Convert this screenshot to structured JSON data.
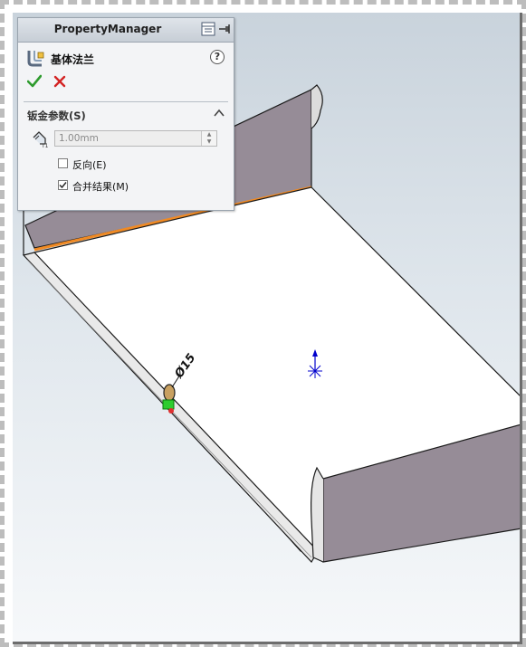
{
  "property_manager": {
    "title": "PropertyManager",
    "feature_name": "基体法兰",
    "help_symbol": "?",
    "ok_icon": "check-icon",
    "cancel_icon": "x-icon",
    "group": {
      "title": "钣金参数(S)",
      "thickness": {
        "value": "1.00mm"
      },
      "reverse_direction": {
        "label": "反向(E)",
        "checked": false
      },
      "merge_result": {
        "label": "合并结果(M)",
        "checked": true
      }
    }
  },
  "viewport": {
    "dimension_label": "Ø15"
  },
  "colors": {
    "ok": "#2e9b2e",
    "cancel": "#d32424",
    "wall": "#968c97",
    "edge_highlight": "#f08a24",
    "axis": "#0000cc"
  }
}
